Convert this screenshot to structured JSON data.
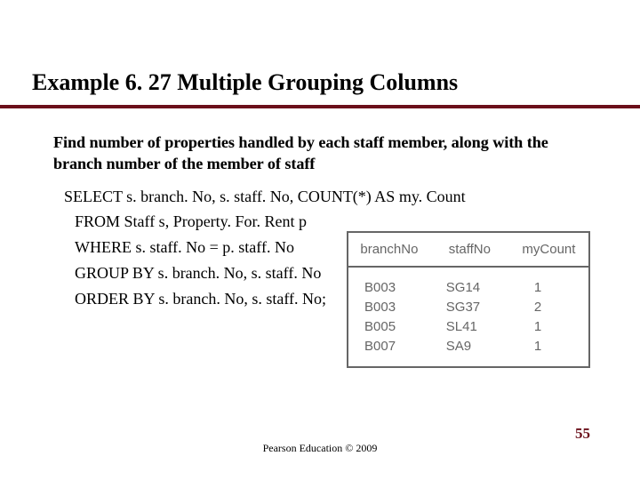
{
  "title": "Example 6. 27  Multiple Grouping Columns",
  "intro": "Find number of properties handled by each staff member, along with the branch number of the member of staff",
  "sql": {
    "l1": "SELECT s. branch. No, s. staff. No, COUNT(*) AS my. Count",
    "l2": "FROM Staff s, Property. For. Rent p",
    "l3": "WHERE s. staff. No = p. staff. No",
    "l4": "GROUP BY s. branch. No, s. staff. No",
    "l5": "ORDER BY s. branch. No, s. staff. No;"
  },
  "table": {
    "headers": [
      "branchNo",
      "staffNo",
      "myCount"
    ],
    "rows": [
      [
        "B003",
        "SG14",
        "1"
      ],
      [
        "B003",
        "SG37",
        "2"
      ],
      [
        "B005",
        "SL41",
        "1"
      ],
      [
        "B007",
        "SA9",
        "1"
      ]
    ]
  },
  "footer": "Pearson Education © 2009",
  "page": "55"
}
